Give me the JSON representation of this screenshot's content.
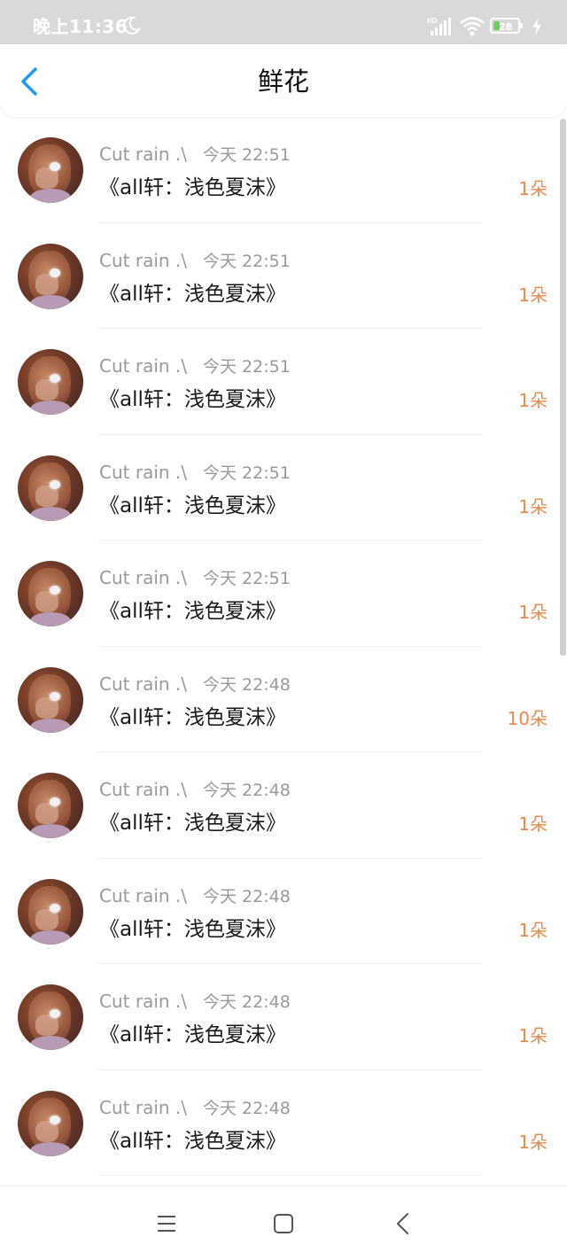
{
  "status_bar": {
    "time": "晚上11:36",
    "battery": 28,
    "icons": [
      "moon-icon",
      "hd-signal-icon",
      "wifi-icon",
      "battery-icon",
      "charging-icon"
    ]
  },
  "header": {
    "title": "鲜花",
    "back_icon": "chevron-left-icon"
  },
  "colors": {
    "accent_blue": "#1e9be9",
    "amount_orange": "#e88a4e",
    "meta_gray": "#9a9a9a",
    "status_bar_bg": "#d9d9d9"
  },
  "list": {
    "items": [
      {
        "user": "Cut rain .\\",
        "time": "今天 22:51",
        "title": "《all轩：浅色夏沫》",
        "amount": "1朵"
      },
      {
        "user": "Cut rain .\\",
        "time": "今天 22:51",
        "title": "《all轩：浅色夏沫》",
        "amount": "1朵"
      },
      {
        "user": "Cut rain .\\",
        "time": "今天 22:51",
        "title": "《all轩：浅色夏沫》",
        "amount": "1朵"
      },
      {
        "user": "Cut rain .\\",
        "time": "今天 22:51",
        "title": "《all轩：浅色夏沫》",
        "amount": "1朵"
      },
      {
        "user": "Cut rain .\\",
        "time": "今天 22:51",
        "title": "《all轩：浅色夏沫》",
        "amount": "1朵"
      },
      {
        "user": "Cut rain .\\",
        "time": "今天 22:48",
        "title": "《all轩：浅色夏沫》",
        "amount": "10朵"
      },
      {
        "user": "Cut rain .\\",
        "time": "今天 22:48",
        "title": "《all轩：浅色夏沫》",
        "amount": "1朵"
      },
      {
        "user": "Cut rain .\\",
        "time": "今天 22:48",
        "title": "《all轩：浅色夏沫》",
        "amount": "1朵"
      },
      {
        "user": "Cut rain .\\",
        "time": "今天 22:48",
        "title": "《all轩：浅色夏沫》",
        "amount": "1朵"
      },
      {
        "user": "Cut rain .\\",
        "time": "今天 22:48",
        "title": "《all轩：浅色夏沫》",
        "amount": "1朵"
      }
    ]
  },
  "nav_bar": {
    "icons": [
      "menu-icon",
      "home-square-icon",
      "back-triangle-icon"
    ]
  }
}
